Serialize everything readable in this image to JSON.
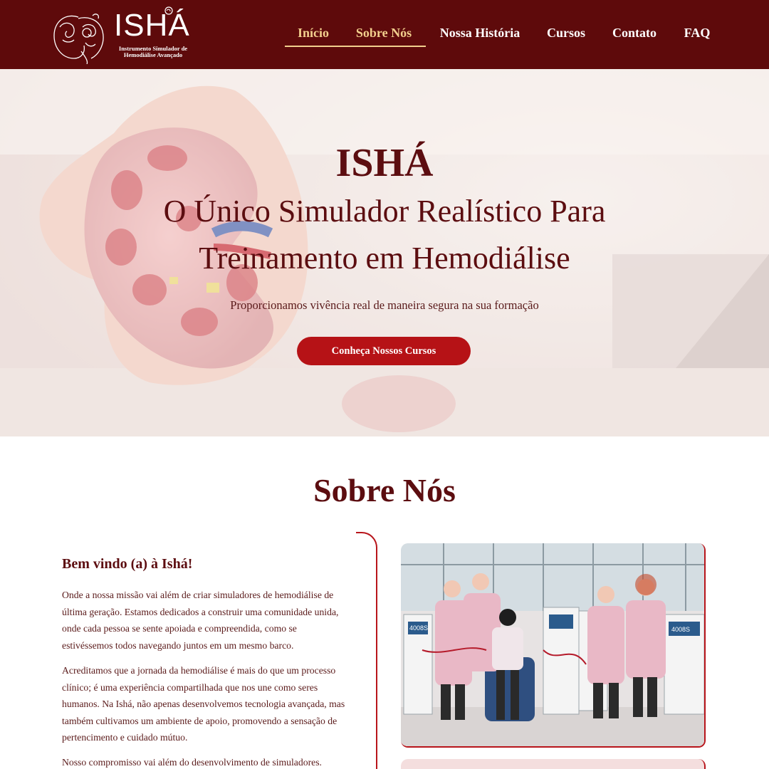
{
  "brand": {
    "name": "ISHÁ",
    "subtitle_line1": "Instrumento Simulador de",
    "subtitle_line2": "Hemodiálise Avançado",
    "logo_icon": "woman-face-flower-logo"
  },
  "nav": {
    "items": [
      {
        "label": "Início",
        "active": true
      },
      {
        "label": "Sobre Nós",
        "active": true
      },
      {
        "label": "Nossa História",
        "active": false
      },
      {
        "label": "Cursos",
        "active": false
      },
      {
        "label": "Contato",
        "active": false
      },
      {
        "label": "FAQ",
        "active": false
      }
    ]
  },
  "hero": {
    "title": "ISHÁ",
    "headline_line1": "O Único Simulador Realístico Para",
    "headline_line2": "Treinamento em Hemodiálise",
    "tagline": "Proporcionamos vivência real de maneira segura na sua formação",
    "cta": "Conheça Nossos Cursos",
    "background_image": "hand-holding-kidney-model"
  },
  "about": {
    "title": "Sobre Nós",
    "welcome": "Bem vindo (a) à Ishá!",
    "paragraphs": [
      [
        "Onde a nossa missão vai além de criar simuladores de hemodiálise de",
        "última geração. Estamos dedicados a construir uma comunidade unida,",
        "onde cada pessoa se sente apoiada e compreendida, como se",
        "estivéssemos todos navegando juntos em um mesmo barco."
      ],
      [
        "Acreditamos que a jornada da hemodiálise é mais do que um processo",
        "clínico; é uma experiência compartilhada que nos une como seres",
        "humanos. Na Ishá, não apenas desenvolvemos tecnologia avançada, mas",
        "também cultivamos um ambiente de apoio, promovendo a sensação de",
        "pertencimento e cuidado mútuo."
      ],
      [
        "Nosso compromisso vai além do desenvolvimento de simuladores."
      ]
    ],
    "photo": "team-with-dialysis-machines-and-mannequin",
    "machine_label": "4008S"
  },
  "colors": {
    "header_bg": "#5e0a0b",
    "accent_gold": "#f2cf8d",
    "title_maroon": "#5c0d10",
    "button_red": "#b61216",
    "border_red": "#b8151b"
  }
}
